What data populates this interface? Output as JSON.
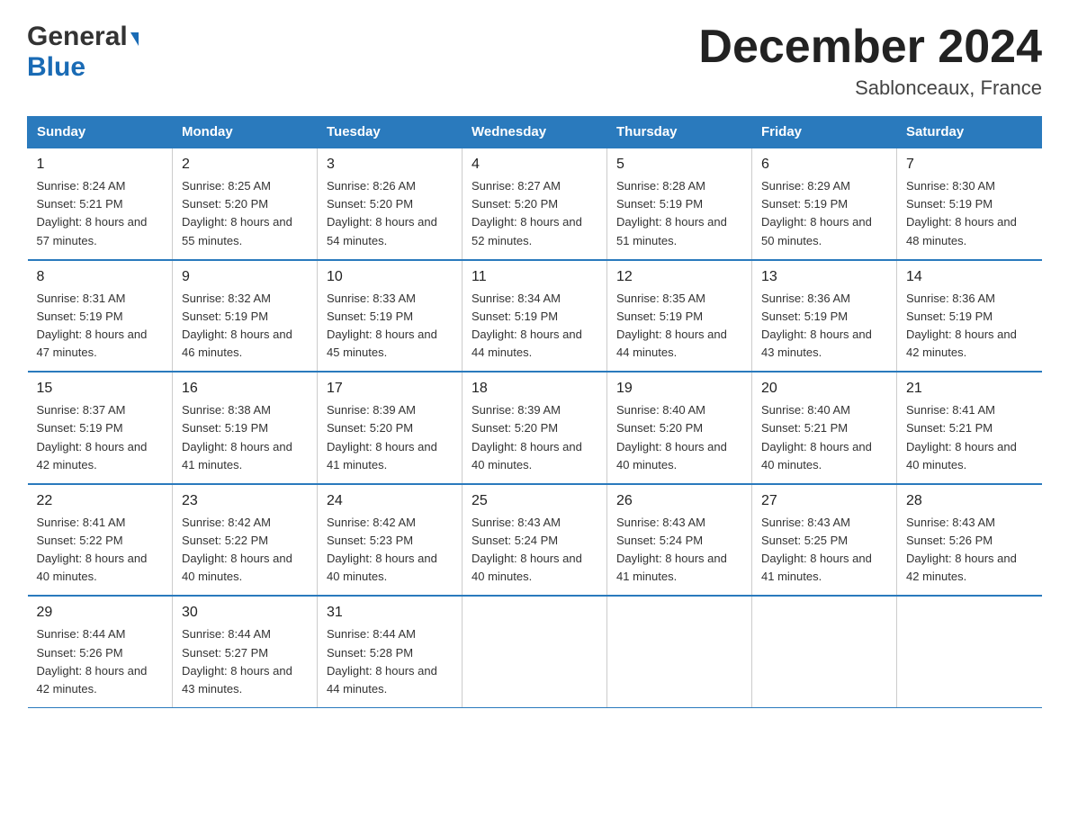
{
  "logo": {
    "general": "General",
    "blue": "Blue"
  },
  "title": "December 2024",
  "location": "Sablonceaux, France",
  "headers": [
    "Sunday",
    "Monday",
    "Tuesday",
    "Wednesday",
    "Thursday",
    "Friday",
    "Saturday"
  ],
  "weeks": [
    [
      {
        "day": "1",
        "sunrise": "8:24 AM",
        "sunset": "5:21 PM",
        "daylight": "8 hours and 57 minutes."
      },
      {
        "day": "2",
        "sunrise": "8:25 AM",
        "sunset": "5:20 PM",
        "daylight": "8 hours and 55 minutes."
      },
      {
        "day": "3",
        "sunrise": "8:26 AM",
        "sunset": "5:20 PM",
        "daylight": "8 hours and 54 minutes."
      },
      {
        "day": "4",
        "sunrise": "8:27 AM",
        "sunset": "5:20 PM",
        "daylight": "8 hours and 52 minutes."
      },
      {
        "day": "5",
        "sunrise": "8:28 AM",
        "sunset": "5:19 PM",
        "daylight": "8 hours and 51 minutes."
      },
      {
        "day": "6",
        "sunrise": "8:29 AM",
        "sunset": "5:19 PM",
        "daylight": "8 hours and 50 minutes."
      },
      {
        "day": "7",
        "sunrise": "8:30 AM",
        "sunset": "5:19 PM",
        "daylight": "8 hours and 48 minutes."
      }
    ],
    [
      {
        "day": "8",
        "sunrise": "8:31 AM",
        "sunset": "5:19 PM",
        "daylight": "8 hours and 47 minutes."
      },
      {
        "day": "9",
        "sunrise": "8:32 AM",
        "sunset": "5:19 PM",
        "daylight": "8 hours and 46 minutes."
      },
      {
        "day": "10",
        "sunrise": "8:33 AM",
        "sunset": "5:19 PM",
        "daylight": "8 hours and 45 minutes."
      },
      {
        "day": "11",
        "sunrise": "8:34 AM",
        "sunset": "5:19 PM",
        "daylight": "8 hours and 44 minutes."
      },
      {
        "day": "12",
        "sunrise": "8:35 AM",
        "sunset": "5:19 PM",
        "daylight": "8 hours and 44 minutes."
      },
      {
        "day": "13",
        "sunrise": "8:36 AM",
        "sunset": "5:19 PM",
        "daylight": "8 hours and 43 minutes."
      },
      {
        "day": "14",
        "sunrise": "8:36 AM",
        "sunset": "5:19 PM",
        "daylight": "8 hours and 42 minutes."
      }
    ],
    [
      {
        "day": "15",
        "sunrise": "8:37 AM",
        "sunset": "5:19 PM",
        "daylight": "8 hours and 42 minutes."
      },
      {
        "day": "16",
        "sunrise": "8:38 AM",
        "sunset": "5:19 PM",
        "daylight": "8 hours and 41 minutes."
      },
      {
        "day": "17",
        "sunrise": "8:39 AM",
        "sunset": "5:20 PM",
        "daylight": "8 hours and 41 minutes."
      },
      {
        "day": "18",
        "sunrise": "8:39 AM",
        "sunset": "5:20 PM",
        "daylight": "8 hours and 40 minutes."
      },
      {
        "day": "19",
        "sunrise": "8:40 AM",
        "sunset": "5:20 PM",
        "daylight": "8 hours and 40 minutes."
      },
      {
        "day": "20",
        "sunrise": "8:40 AM",
        "sunset": "5:21 PM",
        "daylight": "8 hours and 40 minutes."
      },
      {
        "day": "21",
        "sunrise": "8:41 AM",
        "sunset": "5:21 PM",
        "daylight": "8 hours and 40 minutes."
      }
    ],
    [
      {
        "day": "22",
        "sunrise": "8:41 AM",
        "sunset": "5:22 PM",
        "daylight": "8 hours and 40 minutes."
      },
      {
        "day": "23",
        "sunrise": "8:42 AM",
        "sunset": "5:22 PM",
        "daylight": "8 hours and 40 minutes."
      },
      {
        "day": "24",
        "sunrise": "8:42 AM",
        "sunset": "5:23 PM",
        "daylight": "8 hours and 40 minutes."
      },
      {
        "day": "25",
        "sunrise": "8:43 AM",
        "sunset": "5:24 PM",
        "daylight": "8 hours and 40 minutes."
      },
      {
        "day": "26",
        "sunrise": "8:43 AM",
        "sunset": "5:24 PM",
        "daylight": "8 hours and 41 minutes."
      },
      {
        "day": "27",
        "sunrise": "8:43 AM",
        "sunset": "5:25 PM",
        "daylight": "8 hours and 41 minutes."
      },
      {
        "day": "28",
        "sunrise": "8:43 AM",
        "sunset": "5:26 PM",
        "daylight": "8 hours and 42 minutes."
      }
    ],
    [
      {
        "day": "29",
        "sunrise": "8:44 AM",
        "sunset": "5:26 PM",
        "daylight": "8 hours and 42 minutes."
      },
      {
        "day": "30",
        "sunrise": "8:44 AM",
        "sunset": "5:27 PM",
        "daylight": "8 hours and 43 minutes."
      },
      {
        "day": "31",
        "sunrise": "8:44 AM",
        "sunset": "5:28 PM",
        "daylight": "8 hours and 44 minutes."
      },
      null,
      null,
      null,
      null
    ]
  ]
}
